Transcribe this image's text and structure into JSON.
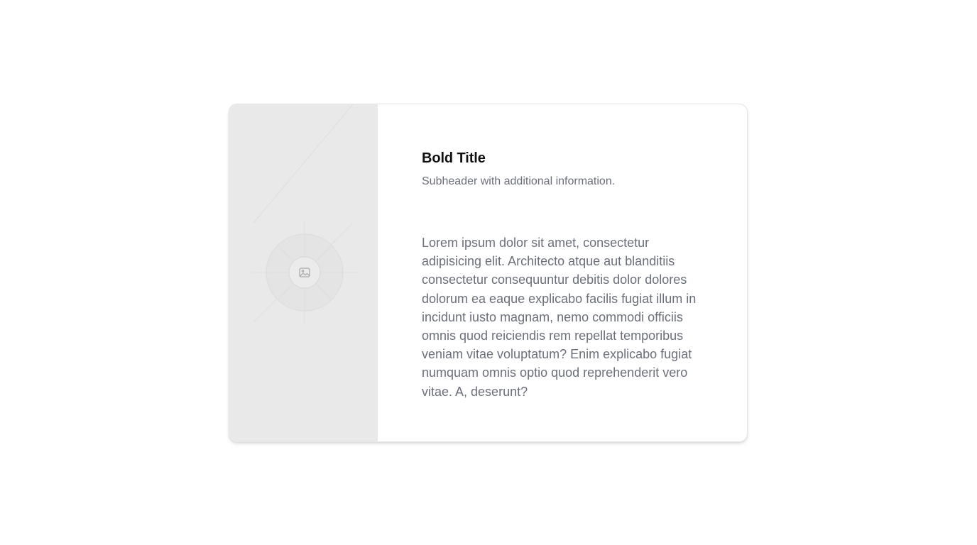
{
  "card": {
    "title": "Bold Title",
    "subtitle": "Subheader with additional information.",
    "body": "Lorem ipsum dolor sit amet, consectetur adipisicing elit. Architecto atque aut blanditiis consectetur consequuntur debitis dolor dolores dolorum ea eaque explicabo facilis fugiat illum in incidunt iusto magnam, nemo commodi officiis omnis quod reiciendis rem repellat temporibus veniam vitae voluptatum? Enim explicabo fugiat numquam omnis optio quod reprehenderit vero vitae. A, deserunt?",
    "media": {
      "icon": "image-placeholder-icon"
    }
  },
  "colors": {
    "page_background": "#ffffff",
    "card_background": "#ffffff",
    "media_background": "#e9e9e9",
    "title": "#111111",
    "muted_text": "#6b6f7a"
  }
}
